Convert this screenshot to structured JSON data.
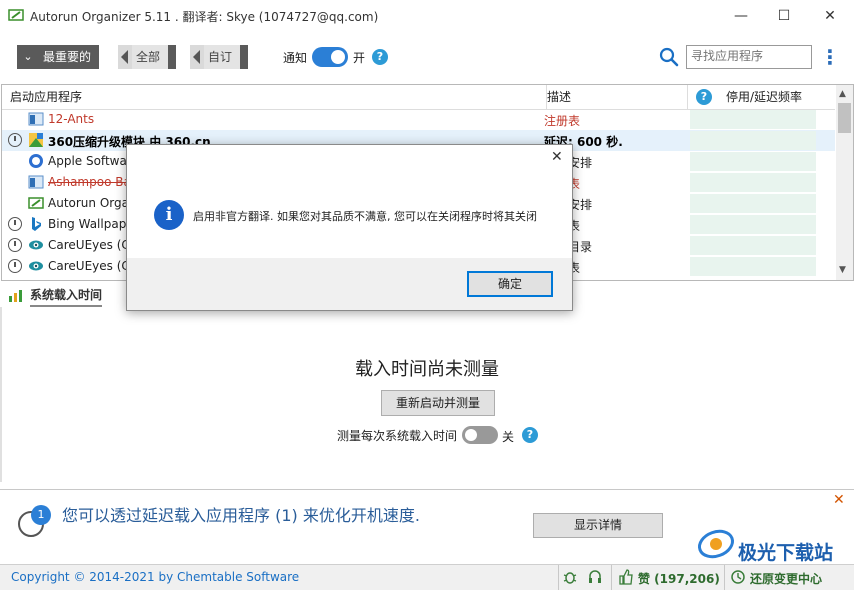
{
  "window": {
    "title": "Autorun Organizer 5.11 . 翻译者: Skye (1074727@qq.com)",
    "minimize": "—",
    "maximize": "☐",
    "close": "✕"
  },
  "toolbar": {
    "important_label": "最重要的",
    "all_label": "全部",
    "custom_label": "自订",
    "notify_label": "通知",
    "notify_state": "开",
    "help": "?",
    "search_placeholder": "寻找应用程序",
    "more": "⋮"
  },
  "table": {
    "headers": {
      "app": "启动应用程序",
      "desc": "描述",
      "freq": "停用/延迟频率",
      "help": "?"
    },
    "rows": [
      {
        "name": "12-Ants",
        "desc": "注册表",
        "name_color": "#c0392b",
        "desc_color": "#c0392b",
        "clock": false,
        "icon": "window-icon",
        "bold": false,
        "strike": false
      },
      {
        "name": "360压缩升级模块 由 360.cn",
        "desc": "延迟: 600 秒.",
        "name_color": "#000000",
        "desc_color": "#000000",
        "clock": true,
        "icon": "360-icon",
        "bold": true,
        "strike": false
      },
      {
        "name": "Apple Software",
        "desc": "任务安排",
        "name_color": "#222222",
        "desc_color": "#222222",
        "clock": false,
        "icon": "apple-update-icon",
        "bold": false,
        "strike": false
      },
      {
        "name": "Ashampoo Bac",
        "desc": "注册表",
        "name_color": "#c0392b",
        "desc_color": "#c0392b",
        "clock": false,
        "icon": "window-icon",
        "bold": false,
        "strike": true
      },
      {
        "name": "Autorun Organ",
        "desc": "任务安排",
        "name_color": "#222222",
        "desc_color": "#222222",
        "clock": false,
        "icon": "autorun-icon",
        "bold": false,
        "strike": false
      },
      {
        "name": "Bing Wallpaper",
        "desc": "注册表",
        "name_color": "#222222",
        "desc_color": "#222222",
        "clock": true,
        "icon": "bing-icon",
        "bold": false,
        "strike": false
      },
      {
        "name": "CareUEyes (Car",
        "desc": "启动目录",
        "name_color": "#222222",
        "desc_color": "#222222",
        "clock": true,
        "icon": "eye-icon",
        "bold": false,
        "strike": false
      },
      {
        "name": "CareUEyes (Car",
        "desc": "注册表",
        "name_color": "#222222",
        "desc_color": "#222222",
        "clock": true,
        "icon": "eye-icon",
        "bold": false,
        "strike": false
      }
    ]
  },
  "load_pane": {
    "tab_label": "系统载入时间",
    "not_measured": "载入时间尚未测量",
    "restart_button": "重新启动并测量",
    "measure_label": "测量每次系统载入时间",
    "measure_state": "关"
  },
  "tip": {
    "badge": "1",
    "text": "您可以透过延迟载入应用程序 (1) 来优化开机速度.",
    "details_button": "显示详情",
    "close": "✕"
  },
  "statusbar": {
    "copyright": "Copyright © 2014-2021 by Chemtable Software",
    "likes": "赞 (197,206)",
    "restore": "还原变更中心"
  },
  "watermark": {
    "text": "极光下载站"
  },
  "dialog": {
    "close": "✕",
    "info": "i",
    "message": "启用非官方翻译. 如果您对其品质不满意, 您可以在关闭程序时将其关闭",
    "ok": "确定"
  },
  "colors": {
    "accent": "#2b7fd6",
    "link": "#1a6fc4",
    "error": "#c0392b",
    "dialog_icon": "#1a62c8"
  }
}
